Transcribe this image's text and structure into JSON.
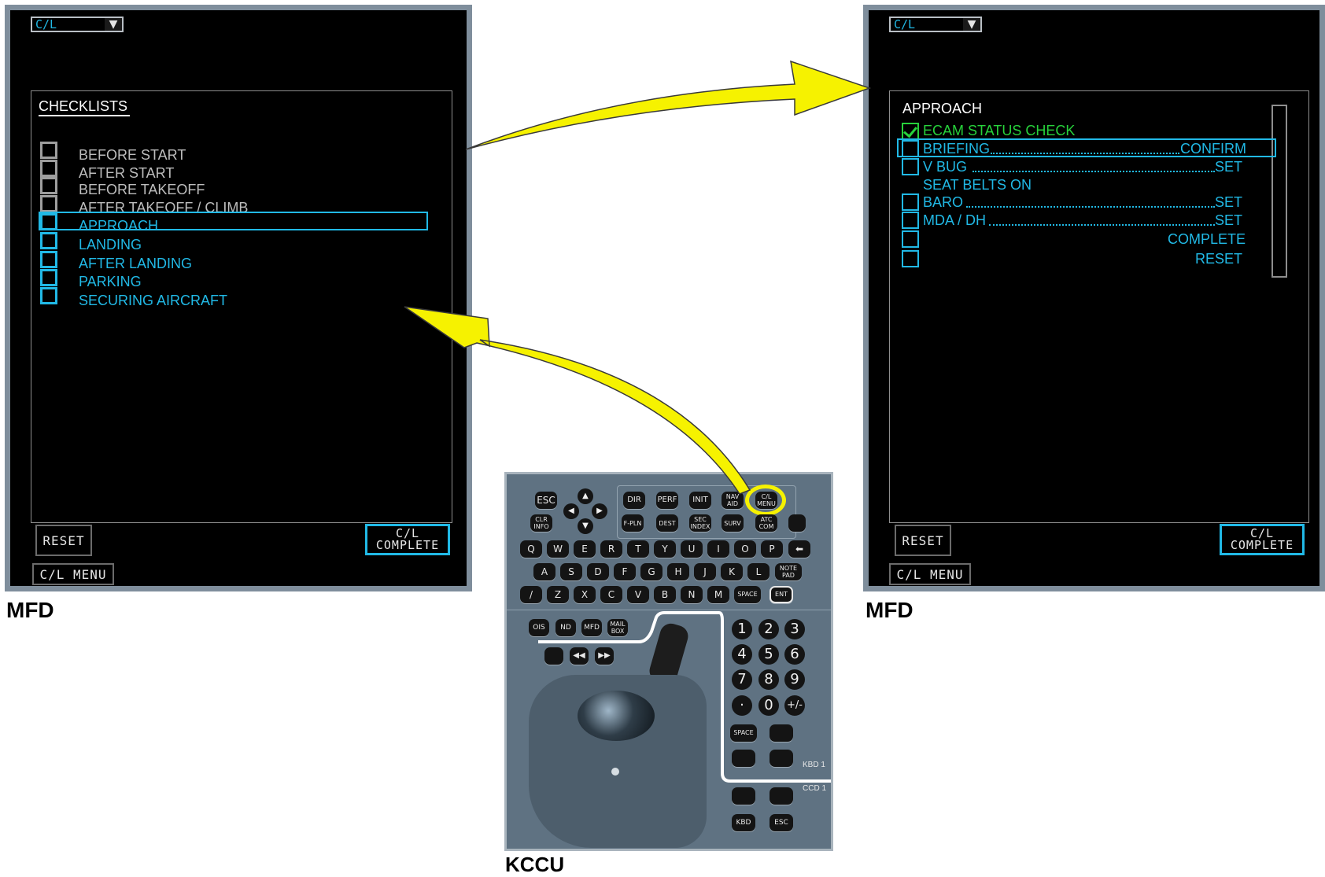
{
  "mfd_left": {
    "dropdown": "C/L",
    "title": "CHECKLISTS",
    "items": [
      {
        "label": "BEFORE START",
        "state": "done"
      },
      {
        "label": "AFTER START",
        "state": "done"
      },
      {
        "label": "BEFORE TAKEOFF",
        "state": "done"
      },
      {
        "label": "AFTER TAKEOFF / CLIMB",
        "state": "done"
      },
      {
        "label": "APPROACH",
        "state": "selected"
      },
      {
        "label": "LANDING",
        "state": "pending"
      },
      {
        "label": "AFTER LANDING",
        "state": "pending"
      },
      {
        "label": "PARKING",
        "state": "pending"
      },
      {
        "label": "SECURING AIRCRAFT",
        "state": "pending"
      }
    ],
    "reset": "RESET",
    "complete_line1": "C/L",
    "complete_line2": "COMPLETE",
    "menu": "C/L MENU",
    "caption": "MFD"
  },
  "mfd_right": {
    "dropdown": "C/L",
    "title": "APPROACH",
    "items": [
      {
        "label": "ECAM STATUS CHECK",
        "value": "",
        "state": "checked"
      },
      {
        "label": "BRIEFING",
        "value": "CONFIRM",
        "state": "selected"
      },
      {
        "label": "V BUG",
        "value": "SET",
        "state": "pending"
      },
      {
        "label": "SEAT BELTS ON",
        "value": "",
        "state": "note"
      },
      {
        "label": "BARO",
        "value": "SET",
        "state": "pending"
      },
      {
        "label": "MDA / DH",
        "value": "SET",
        "state": "pending"
      },
      {
        "label": "",
        "value": "COMPLETE",
        "state": "pending"
      },
      {
        "label": "",
        "value": "RESET",
        "state": "pending"
      }
    ],
    "reset": "RESET",
    "complete_line1": "C/L",
    "complete_line2": "COMPLETE",
    "menu": "C/L MENU",
    "caption": "MFD"
  },
  "kccu": {
    "caption": "KCCU",
    "top_keys": [
      "ESC",
      "CLR INFO",
      "DIR",
      "PERF",
      "INIT",
      "NAV AID",
      "C/L MENU",
      "F-PLN",
      "DEST",
      "SEC INDEX",
      "SURV",
      "ATC COM"
    ],
    "row_q": [
      "Q",
      "W",
      "E",
      "R",
      "T",
      "Y",
      "U",
      "I",
      "O",
      "P"
    ],
    "row_a": [
      "A",
      "S",
      "D",
      "F",
      "G",
      "H",
      "J",
      "K",
      "L"
    ],
    "row_z": [
      "/",
      "Z",
      "X",
      "C",
      "V",
      "B",
      "N",
      "M"
    ],
    "space": "SPACE",
    "note_pad": "NOTE PAD",
    "ent": "ENT",
    "display_keys": [
      "OIS",
      "ND",
      "MFD",
      "MAIL BOX"
    ],
    "numpad": [
      "1",
      "2",
      "3",
      "4",
      "5",
      "6",
      "7",
      "8",
      "9",
      "·",
      "0",
      "+/-"
    ],
    "num_space": "SPACE",
    "kbd1": "KBD 1",
    "ccd1": "CCD 1",
    "kbd": "KBD",
    "esc_bottom": "ESC"
  },
  "colors": {
    "cyan": "#21b9e6",
    "green": "#27d23b",
    "gray": "#bdbdbd",
    "arrow": "#f6f200"
  }
}
